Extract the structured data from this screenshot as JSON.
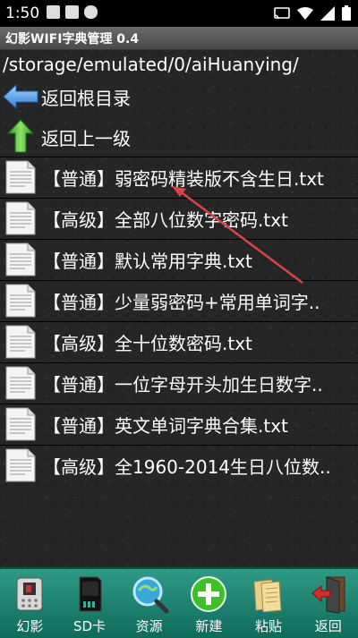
{
  "status_bar": {
    "time": "1:50"
  },
  "app": {
    "title": "幻影WIFI字典管理 0.4"
  },
  "path": "/storage/emulated/0/aiHuanying/",
  "nav": [
    {
      "label": "返回根目录",
      "icon": "left-arrow-icon"
    },
    {
      "label": "返回上一级",
      "icon": "up-arrow-icon"
    }
  ],
  "files": [
    {
      "label": "【普通】弱密码精装版不含生日.txt"
    },
    {
      "label": "【高级】全部八位数字密码.txt"
    },
    {
      "label": "【普通】默认常用字典.txt"
    },
    {
      "label": "【普通】少量弱密码+常用单词字.."
    },
    {
      "label": "【高级】全十位数密码.txt"
    },
    {
      "label": "【普通】一位字母开头加生日数字.."
    },
    {
      "label": "【普通】英文单词字典合集.txt"
    },
    {
      "label": "【高级】全1960-2014生日八位数.."
    }
  ],
  "toolbar": [
    {
      "label": "幻影",
      "icon": "phone-icon"
    },
    {
      "label": "SD卡",
      "icon": "sd-card-icon"
    },
    {
      "label": "资源",
      "icon": "magnifier-globe-icon"
    },
    {
      "label": "新建",
      "icon": "add-icon"
    },
    {
      "label": "粘贴",
      "icon": "paste-icon"
    },
    {
      "label": "返回",
      "icon": "exit-door-icon"
    }
  ],
  "colors": {
    "toolbar": "#1f8573",
    "annotation_arrow": "#d9434a"
  }
}
